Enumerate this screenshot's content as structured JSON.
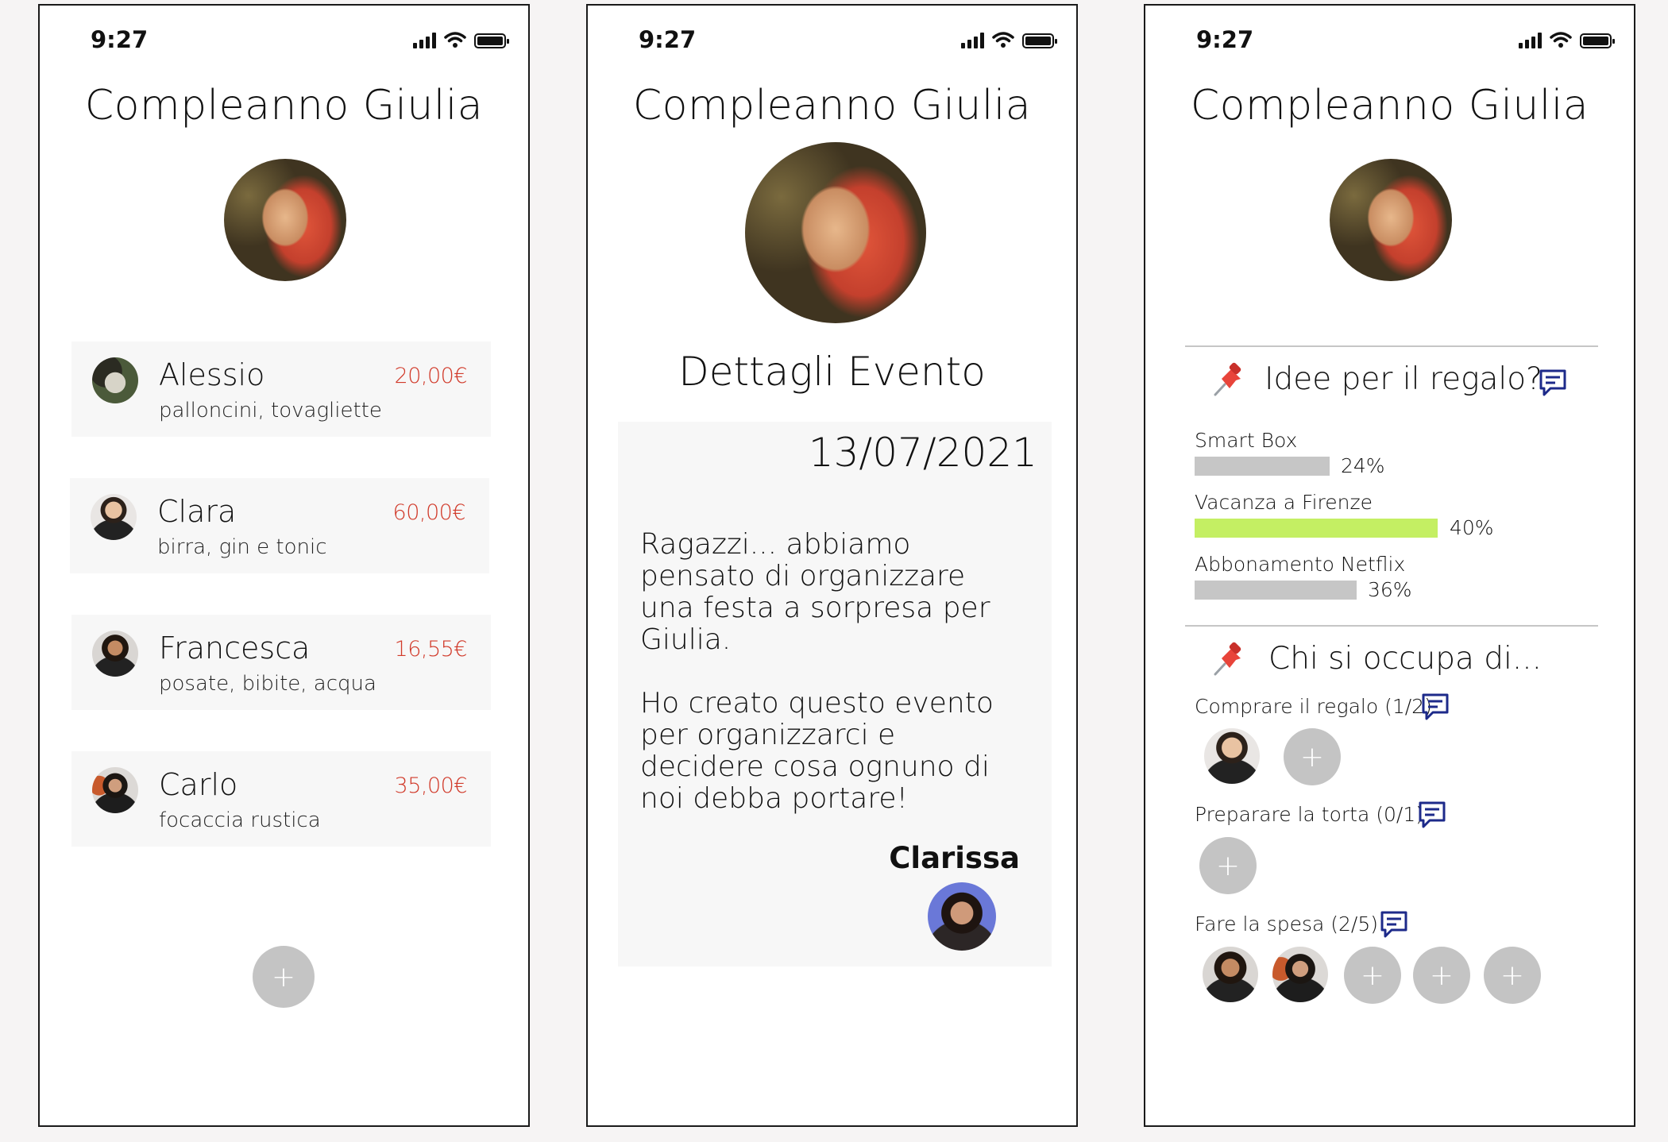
{
  "colors": {
    "price": "#d13a2a",
    "poll_bar": "#c6c6c6",
    "poll_bar_leading": "#c4ef63",
    "icon_blue": "#1d2a8a",
    "plus_button": "#c4c4c4"
  },
  "status_bar": {
    "time": "9:27"
  },
  "phone1": {
    "title": "Compleanno Giulia",
    "items": [
      {
        "name": "Alessio",
        "desc": "palloncini, tovagliette",
        "price": "20,00€"
      },
      {
        "name": "Clara",
        "desc": "birra, gin e tonic",
        "price": "60,00€"
      },
      {
        "name": "Francesca",
        "desc": "posate, bibite, acqua",
        "price": "16,55€"
      },
      {
        "name": "Carlo",
        "desc": "focaccia rustica",
        "price": "35,00€"
      }
    ],
    "add_button": "+"
  },
  "phone2": {
    "title": "Compleanno Giulia",
    "subtitle": "Dettagli Evento",
    "date": "13/07/2021",
    "message": "Ragazzi... abbiamo\npensato di organizzare\nuna festa a sorpresa per\nGiulia.\n\nHo creato questo evento\nper organizzarci e\ndecidere cosa ognuno di\nnoi debba portare!",
    "author": "Clarissa"
  },
  "phone3": {
    "title": "Compleanno Giulia",
    "gift_section": {
      "title": "Idee per il regalo?"
    },
    "poll": [
      {
        "label": "Smart Box",
        "pct_text": "24%",
        "pct": 24
      },
      {
        "label": "Vacanza a Firenze",
        "pct_text": "40%",
        "pct": 40
      },
      {
        "label": "Abbonamento Netflix",
        "pct_text": "36%",
        "pct": 36
      }
    ],
    "tasks_section": {
      "title": "Chi si occupa di..."
    },
    "tasks": [
      {
        "label": "Comprare il regalo (1/2)"
      },
      {
        "label": "Preparare la torta (0/1)"
      },
      {
        "label": "Fare la spesa (2/5)"
      }
    ],
    "add_button": "+"
  }
}
